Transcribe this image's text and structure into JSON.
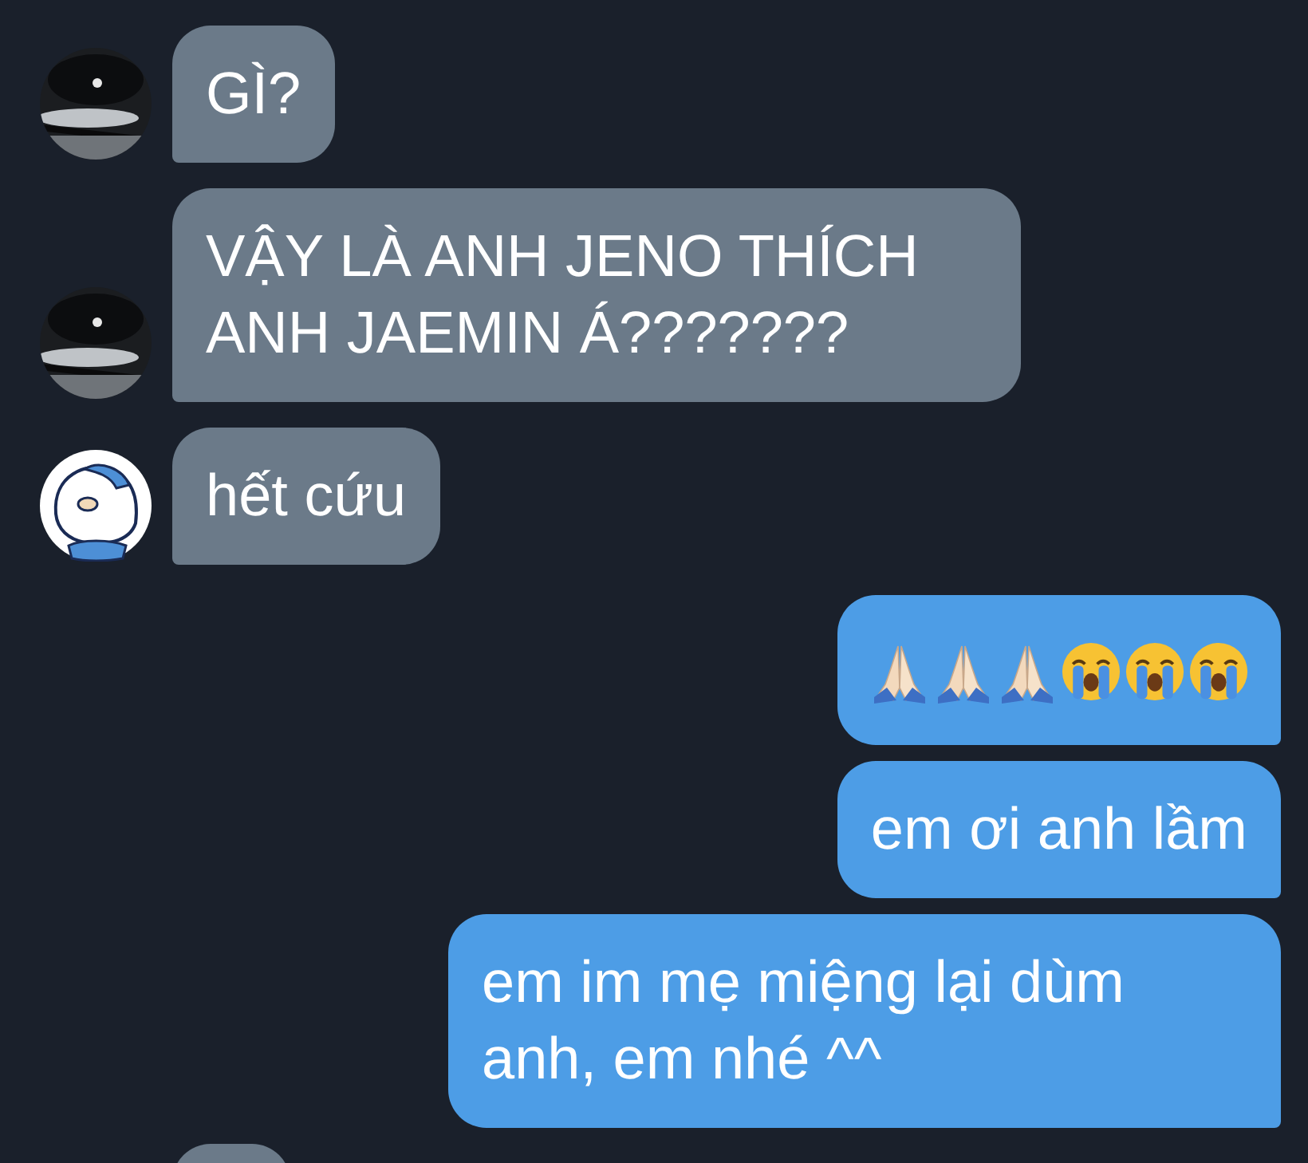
{
  "messages": [
    {
      "outgoing": false,
      "kind": "text",
      "text": "GÌ?"
    },
    {
      "outgoing": false,
      "kind": "text",
      "text": "VẬY LÀ ANH JENO THÍCH ANH JAEMIN Á???????"
    },
    {
      "outgoing": false,
      "kind": "text",
      "avatar": {
        "kind": "cartoon"
      },
      "text": "hết cứu"
    },
    {
      "outgoing": true,
      "kind": "emoji",
      "icons": [
        {
          "kind": "pray"
        },
        {
          "kind": "pray"
        },
        {
          "kind": "pray"
        },
        {
          "kind": "sob"
        },
        {
          "kind": "sob"
        },
        {
          "kind": "sob"
        }
      ]
    },
    {
      "outgoing": true,
      "kind": "text",
      "text": "em ơi anh lầm"
    },
    {
      "outgoing": true,
      "kind": "text",
      "text": "em im mẹ miệng lại dùm anh, em nhé ^^"
    },
    {
      "outgoing": false,
      "kind": "partial"
    }
  ]
}
